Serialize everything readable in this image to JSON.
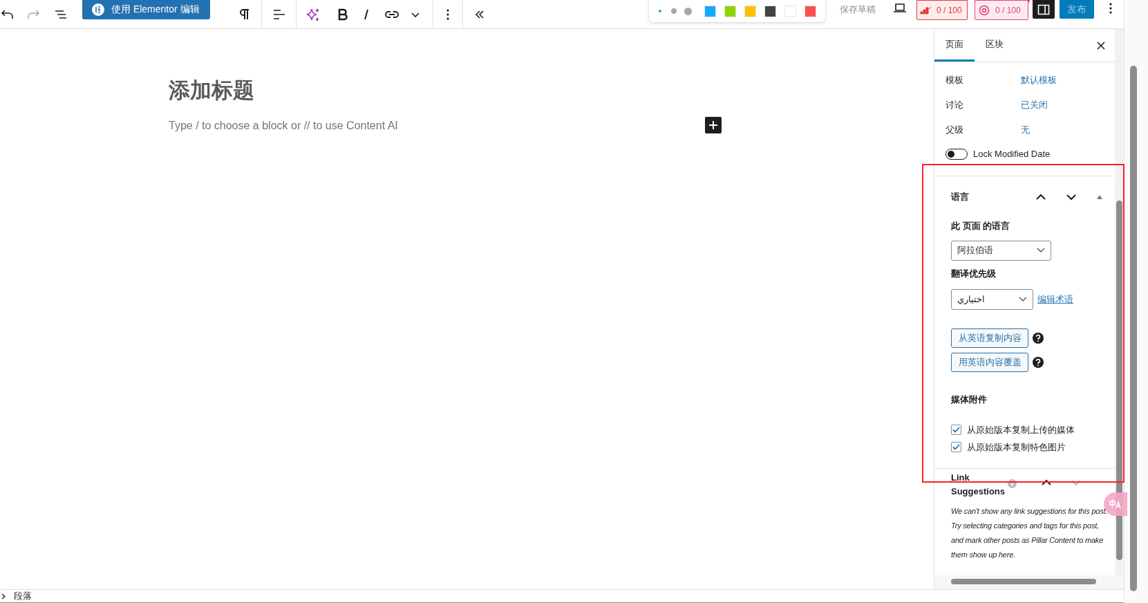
{
  "toolbar": {
    "elementor_button": "使用 Elementor 编辑",
    "save_draft": "保存草稿",
    "seo_score": "0 / 100",
    "readability_score": "0 / 100",
    "publish": "发布"
  },
  "palette": [
    {
      "kind": "dot",
      "color": "#1fb36b"
    },
    {
      "kind": "bigdot",
      "color": "#a6a6a6"
    },
    {
      "kind": "hugedot",
      "color": "#a6a6a6"
    },
    {
      "kind": "square",
      "color": "#11aaff"
    },
    {
      "kind": "square",
      "color": "#8fd400"
    },
    {
      "kind": "square",
      "color": "#ffc000"
    },
    {
      "kind": "square",
      "color": "#444444"
    },
    {
      "kind": "square",
      "color": "#ffffff"
    },
    {
      "kind": "square",
      "color": "#ff5050"
    }
  ],
  "editor": {
    "title_placeholder": "添加标题",
    "block_placeholder": "Type / to choose a block or // to use Content AI"
  },
  "sidebar": {
    "tabs": [
      {
        "label": "页面",
        "selected": true
      },
      {
        "label": "区块",
        "selected": false
      }
    ],
    "settings": [
      {
        "label": "模板",
        "value": "默认模板"
      },
      {
        "label": "讨论",
        "value": "已关闭"
      },
      {
        "label": "父级",
        "value": "无"
      }
    ],
    "lock_toggle": {
      "label": "Lock Modified Date",
      "on": false
    },
    "language_panel": {
      "title": "语言",
      "page_language_label": "此 页面 的语言",
      "page_language": "阿拉伯语",
      "priority_label": "翻译优先级",
      "priority": "اختياري",
      "glossary_link": "编辑术语",
      "buttons": [
        "从英语复制内容",
        "用英语内容覆盖"
      ],
      "media_label": "媒体附件",
      "media_options": [
        {
          "label": "从原始版本复制上传的媒体",
          "checked": true
        },
        {
          "label": "从原始版本复制特色图片",
          "checked": true
        }
      ]
    },
    "link_suggestions": {
      "title": "Link Suggestions",
      "message": "We can't show any link suggestions for this post. Try selecting categories and tags for this post, and mark other posts as Pillar Content to make them show up here."
    }
  },
  "status_bar": {
    "breadcrumb": "段落"
  }
}
